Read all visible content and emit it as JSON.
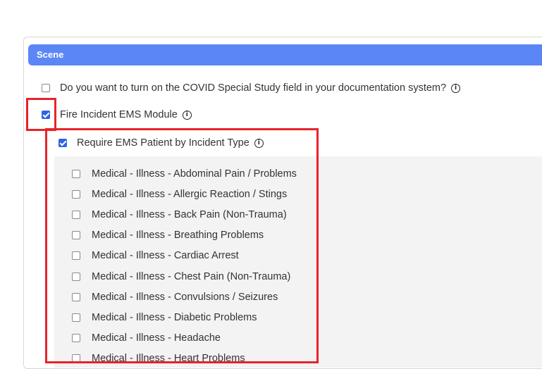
{
  "section": {
    "title": "Scene"
  },
  "options": {
    "covid": {
      "label": "Do you want to turn on the COVID Special Study field in your documentation system?",
      "checked": false
    },
    "fire_ems": {
      "label": "Fire Incident EMS Module",
      "checked": true
    },
    "require_ems": {
      "label": "Require EMS Patient by Incident Type",
      "checked": true
    }
  },
  "incident_types": [
    {
      "label": "Medical - Illness - Abdominal Pain / Problems",
      "checked": false
    },
    {
      "label": "Medical - Illness - Allergic Reaction / Stings",
      "checked": false
    },
    {
      "label": "Medical - Illness - Back Pain (Non-Trauma)",
      "checked": false
    },
    {
      "label": "Medical - Illness - Breathing Problems",
      "checked": false
    },
    {
      "label": "Medical - Illness - Cardiac Arrest",
      "checked": false
    },
    {
      "label": "Medical - Illness - Chest Pain (Non-Trauma)",
      "checked": false
    },
    {
      "label": "Medical - Illness - Convulsions / Seizures",
      "checked": false
    },
    {
      "label": "Medical - Illness - Diabetic Problems",
      "checked": false
    },
    {
      "label": "Medical - Illness - Headache",
      "checked": false
    },
    {
      "label": "Medical - Illness - Heart Problems",
      "checked": false
    }
  ],
  "colors": {
    "header": "#5b86f5",
    "checkbox_checked": "#2f64e8",
    "highlight": "#e8232a",
    "panel_gray": "#f3f3f3"
  },
  "icons": {
    "info": "info-circle-icon"
  }
}
